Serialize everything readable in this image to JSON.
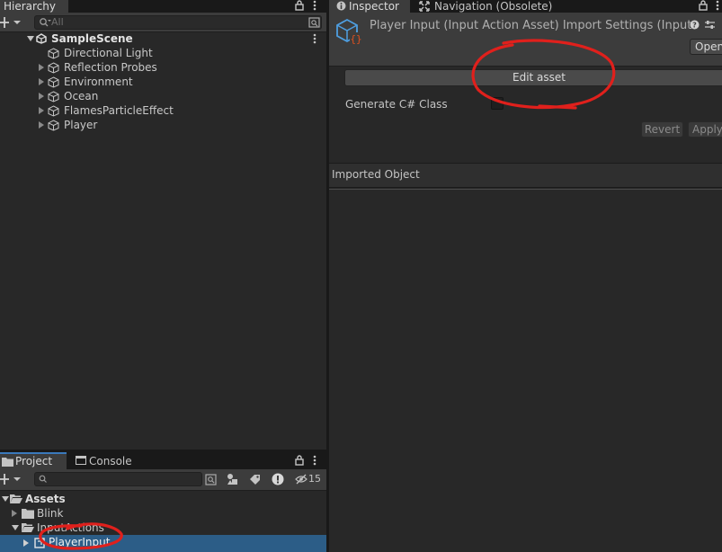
{
  "hierarchy": {
    "tab_label": "Hierarchy",
    "search_placeholder": "All",
    "scene_name": "SampleScene",
    "items": [
      {
        "label": "Directional Light",
        "expandable": false
      },
      {
        "label": "Reflection Probes",
        "expandable": true
      },
      {
        "label": "Environment",
        "expandable": true
      },
      {
        "label": "Ocean",
        "expandable": true
      },
      {
        "label": "FlamesParticleEffect",
        "expandable": true
      },
      {
        "label": "Player",
        "expandable": true
      }
    ]
  },
  "project": {
    "tab_project": "Project",
    "tab_console": "Console",
    "hidden_count": "15",
    "tree": [
      {
        "label": "Assets",
        "level": 0,
        "expanded": true,
        "selected": false
      },
      {
        "label": "Blink",
        "level": 1,
        "expanded": false,
        "selected": false
      },
      {
        "label": "InputActions",
        "level": 1,
        "expanded": true,
        "selected": false
      },
      {
        "label": "PlayerInput",
        "level": 2,
        "expanded": false,
        "selected": true
      }
    ]
  },
  "inspector": {
    "tab_inspector": "Inspector",
    "tab_navigation": "Navigation (Obsolete)",
    "title": "Player Input (Input Action Asset) Import Settings (Input",
    "open_button": "Open",
    "edit_asset_button": "Edit asset",
    "generate_class_label": "Generate C# Class",
    "generate_class_checked": false,
    "revert_button": "Revert",
    "apply_button": "Apply",
    "imported_object_label": "Imported Object"
  },
  "colors": {
    "selection": "#2c5d87",
    "annotation": "#e0201c"
  }
}
